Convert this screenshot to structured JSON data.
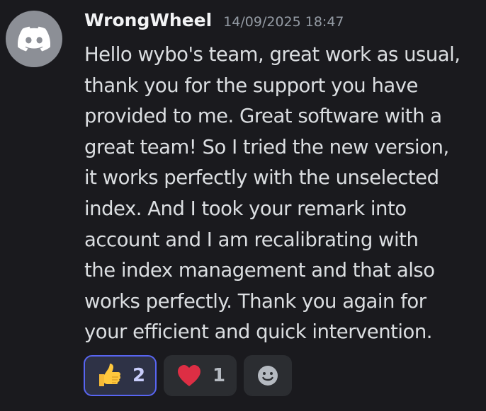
{
  "message": {
    "username": "WrongWheel",
    "timestamp": "14/09/2025 18:47",
    "lines": [
      "Hello wybo's team, great work as usual,",
      "thank you for the support you have",
      "provided to me. Great software with a",
      "great team! So I tried the new version,",
      "it works perfectly with the unselected",
      "index. And I took your remark into",
      "account and I am recalibrating with",
      "the index management and that also",
      "works perfectly. Thank you again for",
      "your efficient and quick intervention."
    ]
  },
  "avatar": {
    "icon": "discord-logo-icon",
    "background": "#8c8f96"
  },
  "reactions": [
    {
      "emoji": "thumbs-up-icon",
      "count": "2",
      "active": true
    },
    {
      "emoji": "red-heart-icon",
      "count": "1",
      "active": false
    },
    {
      "emoji": "add-reaction-smiley-icon"
    }
  ],
  "colors": {
    "background": "#1a1a1e",
    "username": "#f2f3f5",
    "timestamp": "#949ba4",
    "text": "#dbdee1",
    "reaction_bg": "#2b2d31",
    "reaction_active_border": "#5865f2",
    "reaction_active_bg": "#2e3246"
  }
}
